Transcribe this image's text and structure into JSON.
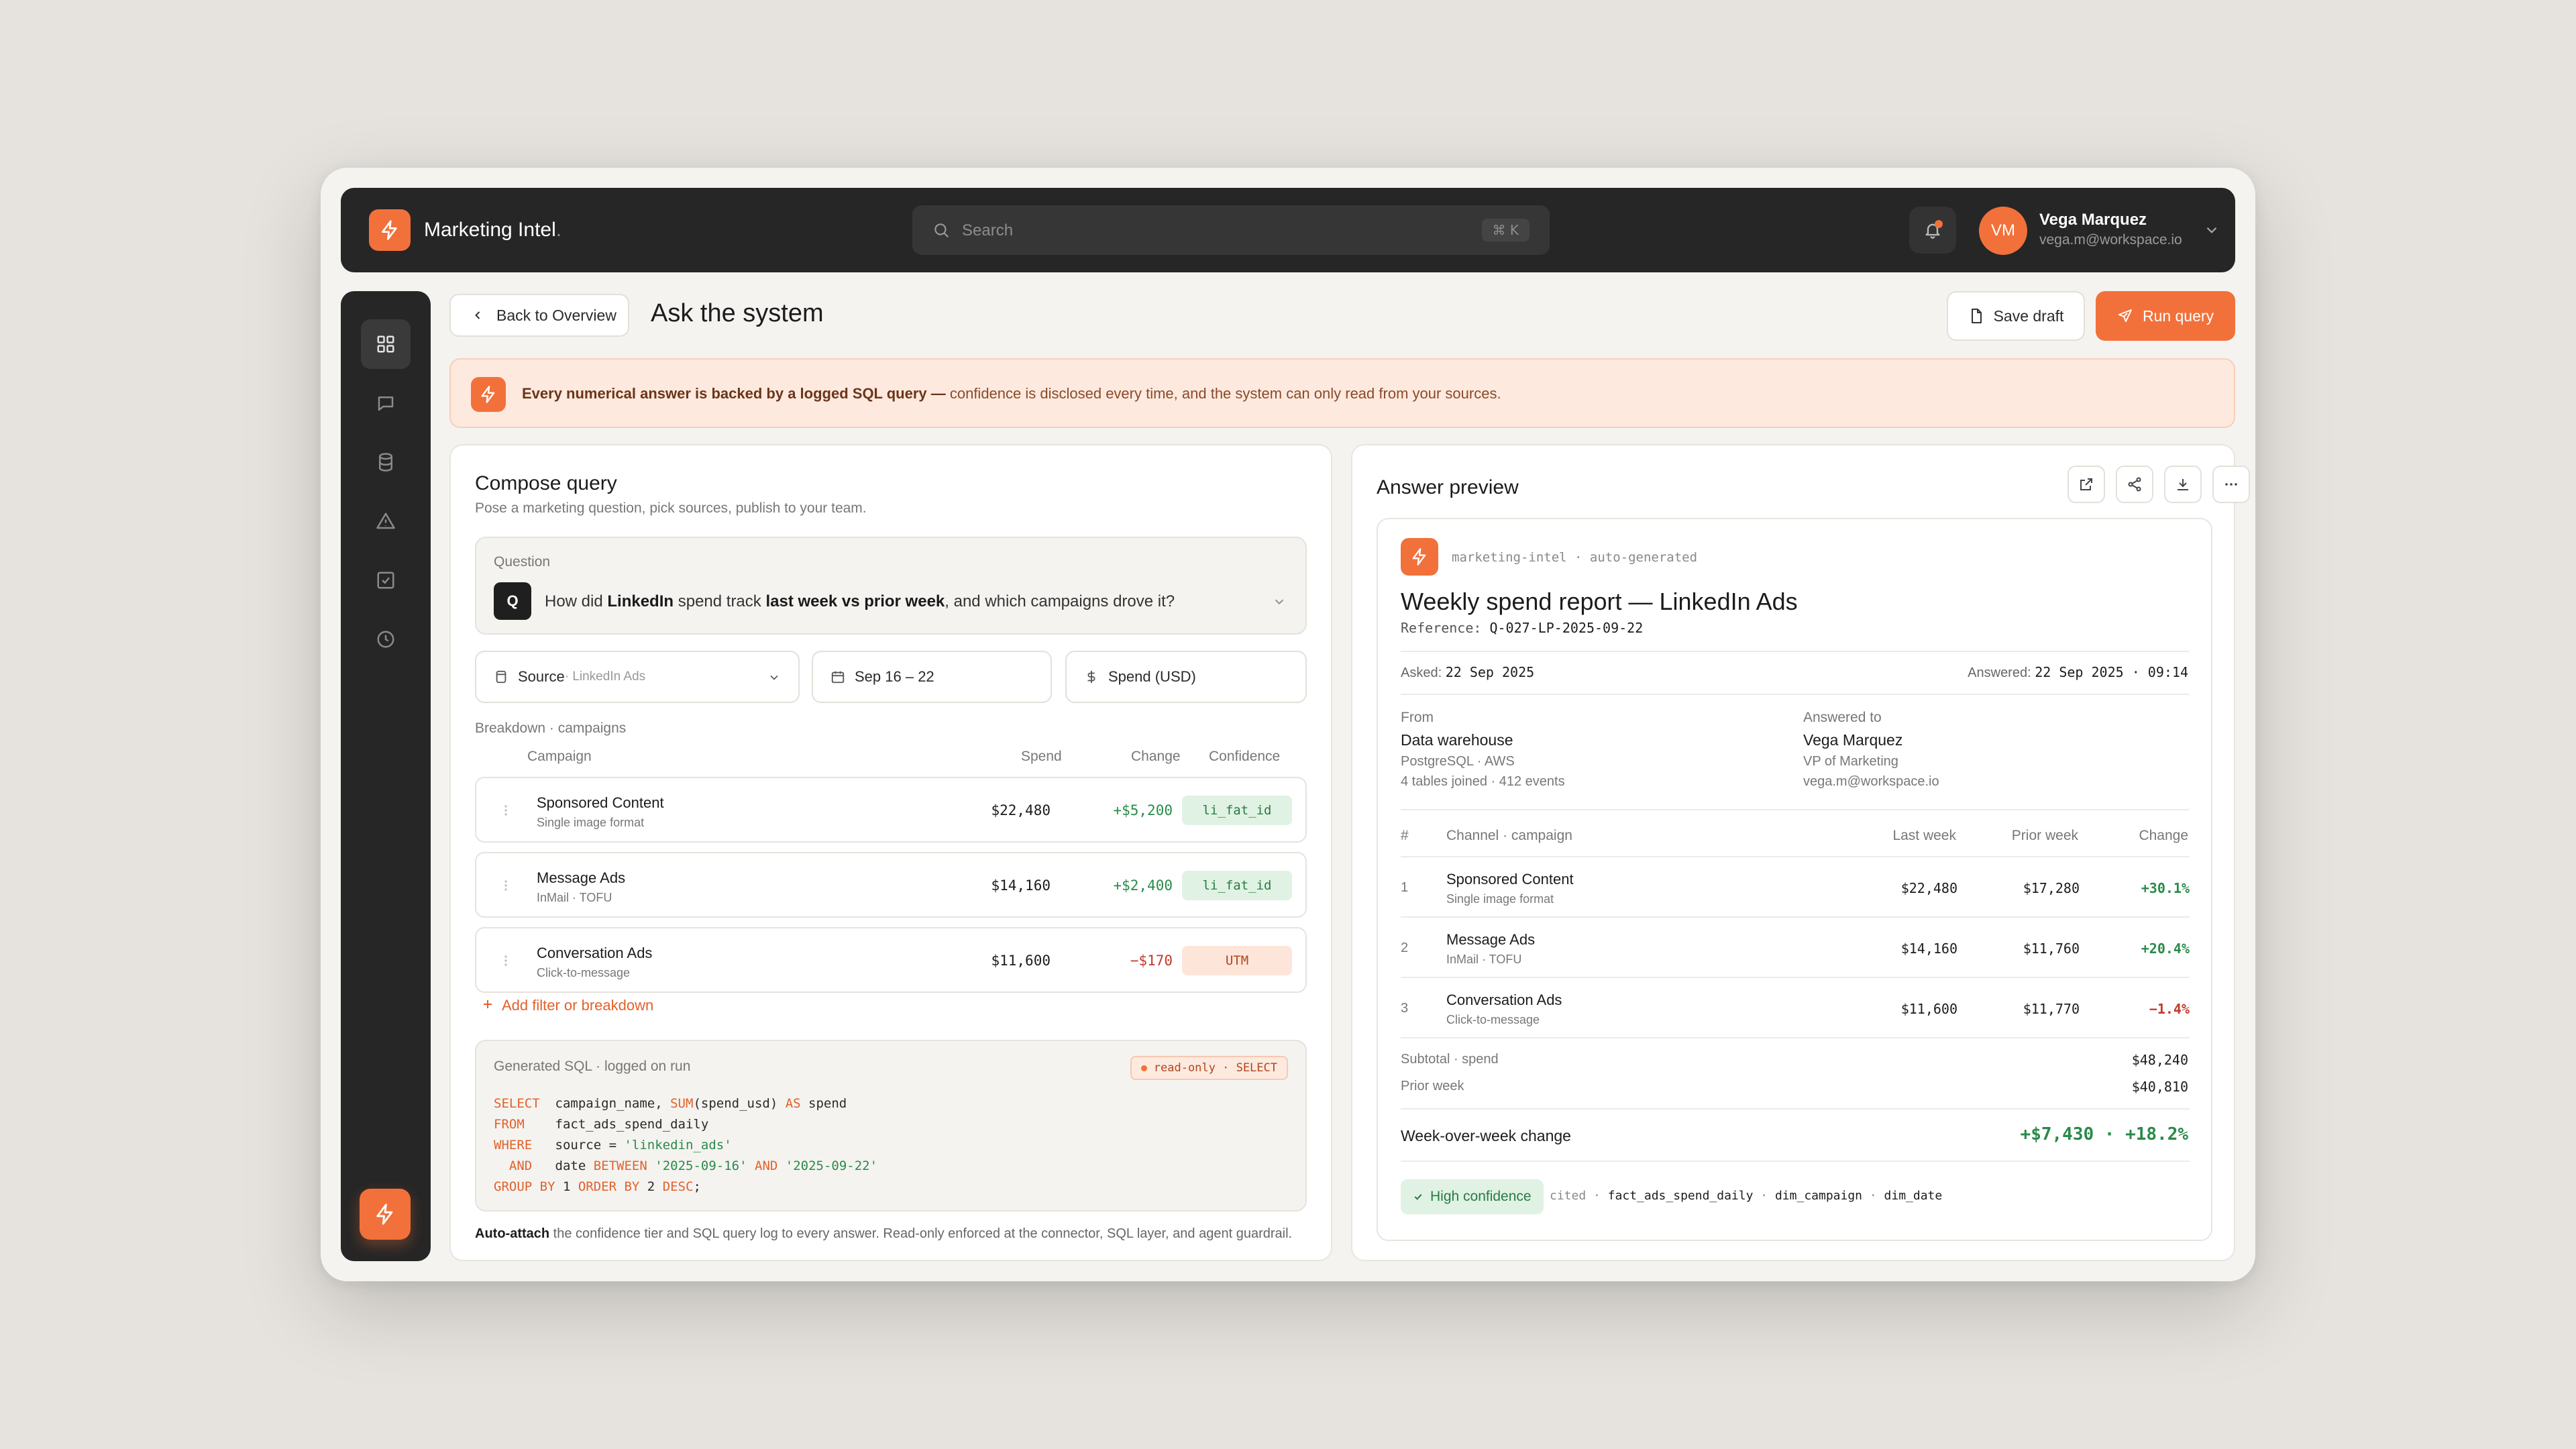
{
  "app": {
    "brand": "Marketing Intel",
    "brand_dot": "."
  },
  "search": {
    "placeholder": "Search",
    "shortcut": "⌘ K"
  },
  "user": {
    "initials": "VM",
    "name": "Vega Marquez",
    "email": "vega.m@workspace.io"
  },
  "header": {
    "back_label": "Back to Overview",
    "title": "Ask the system",
    "save_label": "Save draft",
    "run_label": "Run query"
  },
  "banner": {
    "bold": "Every numerical answer is backed by a logged SQL query —",
    "rest": " confidence is disclosed every time, and the system can only read from your sources."
  },
  "compose": {
    "title": "Compose query",
    "subtitle": "Pose a marketing question, pick sources, publish to your team.",
    "question_label": "Question",
    "question_badge": "Q",
    "question_parts": [
      "How did ",
      "LinkedIn",
      " spend track ",
      "last week vs prior week",
      ", and which campaigns drove it?"
    ],
    "source_label": "Source",
    "source_value": " · LinkedIn Ads",
    "date_range": "Sep 16 – 22",
    "metric": "Spend (USD)",
    "breakdown_label": "Breakdown · campaigns",
    "columns": {
      "campaign": "Campaign",
      "spend": "Spend",
      "change": "Change",
      "confidence": "Confidence"
    },
    "rows": [
      {
        "name": "Sponsored Content",
        "sub": "Single image format",
        "spend": "$22,480",
        "change": "+$5,200",
        "confidence": "li_fat_id"
      },
      {
        "name": "Message Ads",
        "sub": "InMail · TOFU",
        "spend": "$14,160",
        "change": "+$2,400",
        "confidence": "li_fat_id"
      },
      {
        "name": "Conversation Ads",
        "sub": "Click-to-message",
        "spend": "$11,600",
        "change": "−$170",
        "confidence": "UTM"
      }
    ],
    "add_filter": "Add filter or breakdown",
    "sql_label": "Generated SQL · logged on run",
    "sql_pill": "read-only · SELECT",
    "footer_bold": "Auto-attach",
    "footer_rest": " the confidence tier and SQL query log to every answer. Read-only enforced at the connector, SQL layer, and agent guardrail."
  },
  "answer": {
    "title": "Answer preview",
    "meta": "marketing-intel · auto-generated",
    "report_title": "Weekly spend report — LinkedIn Ads",
    "reference_label": "Reference:",
    "reference": "Q-027-LP-2025-09-22",
    "asked_label": "Asked:",
    "asked": "22 Sep 2025",
    "answered_label": "Answered:",
    "answered": "22 Sep 2025 · 09:14",
    "from_label": "From",
    "from_name": "Data warehouse",
    "from_sub1": "PostgreSQL · AWS",
    "from_sub2": "4 tables joined · 412 events",
    "to_label": "Answered to",
    "to_name": "Vega Marquez",
    "to_sub1": "VP of Marketing",
    "to_sub2": "vega.m@workspace.io",
    "columns": {
      "num": "#",
      "channel": "Channel · campaign",
      "last": "Last week",
      "prior": "Prior week",
      "change": "Change"
    },
    "rows": [
      {
        "n": "1",
        "name": "Sponsored Content",
        "sub": "Single image format",
        "last": "$22,480",
        "prior": "$17,280",
        "change": "+30.1%"
      },
      {
        "n": "2",
        "name": "Message Ads",
        "sub": "InMail · TOFU",
        "last": "$14,160",
        "prior": "$11,760",
        "change": "+20.4%"
      },
      {
        "n": "3",
        "name": "Conversation Ads",
        "sub": "Click-to-message",
        "last": "$11,600",
        "prior": "$11,770",
        "change": "−1.4%"
      }
    ],
    "subtotal_label": "Subtotal · spend",
    "subtotal": "$48,240",
    "prior_label": "Prior week",
    "prior": "$40,810",
    "wow_label": "Week-over-week change",
    "wow_value": "+$7,430 · +18.2%",
    "confidence": "High confidence",
    "cited_label": "cited",
    "cited_tables": [
      "fact_ads_spend_daily",
      "dim_campaign",
      "dim_date"
    ]
  },
  "colors": {
    "accent": "#f2713a",
    "dark": "#262626",
    "positive": "#2a8a4a",
    "negative": "#c0392b"
  }
}
